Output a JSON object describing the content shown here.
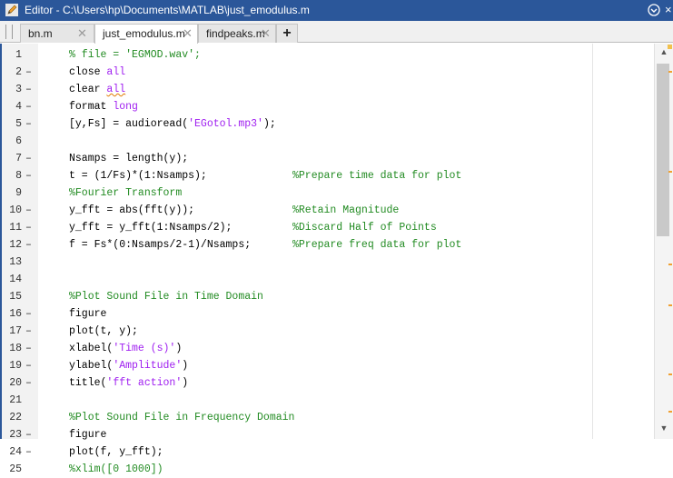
{
  "window": {
    "title": "Editor - C:\\Users\\hp\\Documents\\MATLAB\\just_emodulus.m",
    "app_icon": "editor-pencil-icon",
    "dock_icon": "chevron-down-circle-icon",
    "close_glyph": "×"
  },
  "tabs": [
    {
      "label": "bn.m",
      "active": false
    },
    {
      "label": "just_emodulus.m",
      "active": true
    },
    {
      "label": "findpeaks.m",
      "active": false
    }
  ],
  "add_tab_label": "+",
  "code_lines": [
    {
      "n": "1",
      "dash": "",
      "code": "% file = 'EGMOD.wav';",
      "comment": ""
    },
    {
      "n": "2",
      "dash": "–",
      "code": "close all",
      "comment": ""
    },
    {
      "n": "3",
      "dash": "–",
      "code": "clear all",
      "comment": ""
    },
    {
      "n": "4",
      "dash": "–",
      "code": "format long",
      "comment": ""
    },
    {
      "n": "5",
      "dash": "–",
      "code": "[y,Fs] = audioread('EGotol.mp3');",
      "comment": ""
    },
    {
      "n": "6",
      "dash": "",
      "code": "",
      "comment": ""
    },
    {
      "n": "7",
      "dash": "–",
      "code": "Nsamps = length(y);",
      "comment": ""
    },
    {
      "n": "8",
      "dash": "–",
      "code": "t = (1/Fs)*(1:Nsamps);",
      "comment": "%Prepare time data for plot"
    },
    {
      "n": "9",
      "dash": "",
      "code": "%Fourier Transform",
      "comment": ""
    },
    {
      "n": "10",
      "dash": "–",
      "code": "y_fft = abs(fft(y));",
      "comment": "%Retain Magnitude"
    },
    {
      "n": "11",
      "dash": "–",
      "code": "y_fft = y_fft(1:Nsamps/2);",
      "comment": "%Discard Half of Points"
    },
    {
      "n": "12",
      "dash": "–",
      "code": "f = Fs*(0:Nsamps/2-1)/Nsamps;",
      "comment": "%Prepare freq data for plot"
    },
    {
      "n": "13",
      "dash": "",
      "code": "",
      "comment": ""
    },
    {
      "n": "14",
      "dash": "",
      "code": "",
      "comment": ""
    },
    {
      "n": "15",
      "dash": "",
      "code": "%Plot Sound File in Time Domain",
      "comment": ""
    },
    {
      "n": "16",
      "dash": "–",
      "code": "figure",
      "comment": ""
    },
    {
      "n": "17",
      "dash": "–",
      "code": "plot(t, y);",
      "comment": ""
    },
    {
      "n": "18",
      "dash": "–",
      "code": "xlabel('Time (s)')",
      "comment": ""
    },
    {
      "n": "19",
      "dash": "–",
      "code": "ylabel('Amplitude')",
      "comment": ""
    },
    {
      "n": "20",
      "dash": "–",
      "code": "title('fft action')",
      "comment": ""
    },
    {
      "n": "21",
      "dash": "",
      "code": "",
      "comment": ""
    },
    {
      "n": "22",
      "dash": "",
      "code": "%Plot Sound File in Frequency Domain",
      "comment": ""
    },
    {
      "n": "23",
      "dash": "–",
      "code": "figure",
      "comment": ""
    },
    {
      "n": "24",
      "dash": "–",
      "code": "plot(f, y_fft);",
      "comment": ""
    },
    {
      "n": "25",
      "dash": "",
      "code": "%xlim([0 1000])",
      "comment": ""
    }
  ],
  "scrollbar": {
    "up_glyph": "▲",
    "down_glyph": "▼"
  },
  "colors": {
    "titlebar": "#2b579a",
    "comment": "#228b22",
    "string": "#a020f0",
    "warning_marker": "#f0a030"
  }
}
